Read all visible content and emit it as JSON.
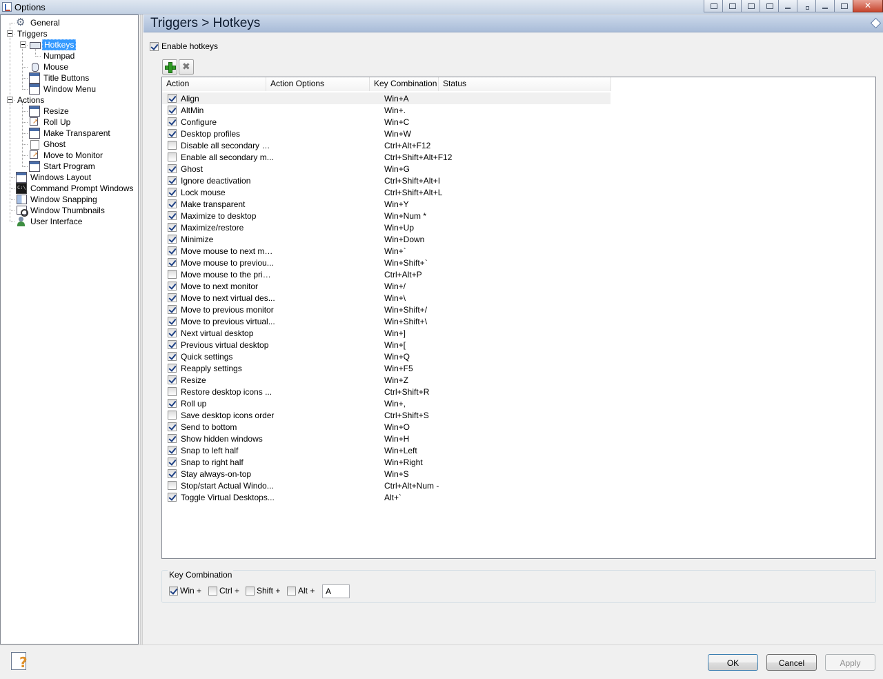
{
  "window": {
    "title": "Options"
  },
  "nav": [
    {
      "label": "General",
      "icon": "gear-icon"
    },
    {
      "label": "Triggers",
      "icon": ""
    },
    {
      "label": "Hotkeys",
      "icon": "keyboard-icon",
      "selected": true
    },
    {
      "label": "Numpad",
      "icon": ""
    },
    {
      "label": "Mouse",
      "icon": "mouse-icon"
    },
    {
      "label": "Title Buttons",
      "icon": "window-icon"
    },
    {
      "label": "Window Menu",
      "icon": "window-icon"
    },
    {
      "label": "Actions",
      "icon": ""
    },
    {
      "label": "Resize",
      "icon": "window-icon"
    },
    {
      "label": "Roll Up",
      "icon": "arrow-icon"
    },
    {
      "label": "Make Transparent",
      "icon": "window-icon"
    },
    {
      "label": "Ghost",
      "icon": "blank-icon"
    },
    {
      "label": "Move to Monitor",
      "icon": "arrow-icon"
    },
    {
      "label": "Start Program",
      "icon": "window-icon"
    },
    {
      "label": "Windows Layout",
      "icon": "window-icon"
    },
    {
      "label": "Command Prompt Windows",
      "icon": "cmd-icon"
    },
    {
      "label": "Window Snapping",
      "icon": "snap-icon"
    },
    {
      "label": "Window Thumbnails",
      "icon": "thumb-icon"
    },
    {
      "label": "User Interface",
      "icon": "user-icon"
    }
  ],
  "header": {
    "title": "Triggers > Hotkeys"
  },
  "enable_hotkeys": {
    "label": "Enable hotkeys",
    "checked": true
  },
  "columns": [
    "Action",
    "Action Options",
    "Key Combination",
    "Status"
  ],
  "rows": [
    {
      "checked": true,
      "action": "Align",
      "options": "",
      "key": "Win+A",
      "status": ""
    },
    {
      "checked": true,
      "action": "AltMin",
      "options": "",
      "key": "Win+.",
      "status": ""
    },
    {
      "checked": true,
      "action": "Configure",
      "options": "",
      "key": "Win+C",
      "status": ""
    },
    {
      "checked": true,
      "action": "Desktop profiles",
      "options": "",
      "key": "Win+W",
      "status": ""
    },
    {
      "checked": false,
      "action": "Disable all secondary m...",
      "options": "",
      "key": "Ctrl+Alt+F12",
      "status": ""
    },
    {
      "checked": false,
      "action": "Enable all secondary m...",
      "options": "",
      "key": "Ctrl+Shift+Alt+F12",
      "status": ""
    },
    {
      "checked": true,
      "action": "Ghost",
      "options": "",
      "key": "Win+G",
      "status": ""
    },
    {
      "checked": true,
      "action": "Ignore deactivation",
      "options": "",
      "key": "Ctrl+Shift+Alt+I",
      "status": ""
    },
    {
      "checked": true,
      "action": "Lock mouse",
      "options": "",
      "key": "Ctrl+Shift+Alt+L",
      "status": ""
    },
    {
      "checked": true,
      "action": "Make transparent",
      "options": "",
      "key": "Win+Y",
      "status": ""
    },
    {
      "checked": true,
      "action": "Maximize to desktop",
      "options": "",
      "key": "Win+Num *",
      "status": ""
    },
    {
      "checked": true,
      "action": "Maximize/restore",
      "options": "",
      "key": "Win+Up",
      "status": ""
    },
    {
      "checked": true,
      "action": "Minimize",
      "options": "",
      "key": "Win+Down",
      "status": ""
    },
    {
      "checked": true,
      "action": "Move mouse to next mo...",
      "options": "",
      "key": "Win+`",
      "status": ""
    },
    {
      "checked": true,
      "action": "Move mouse to previou...",
      "options": "",
      "key": "Win+Shift+`",
      "status": ""
    },
    {
      "checked": false,
      "action": "Move mouse to the prim...",
      "options": "",
      "key": "Ctrl+Alt+P",
      "status": ""
    },
    {
      "checked": true,
      "action": "Move to next monitor",
      "options": "",
      "key": "Win+/",
      "status": ""
    },
    {
      "checked": true,
      "action": "Move to next virtual des...",
      "options": "",
      "key": "Win+\\",
      "status": ""
    },
    {
      "checked": true,
      "action": "Move to previous monitor",
      "options": "",
      "key": "Win+Shift+/",
      "status": ""
    },
    {
      "checked": true,
      "action": "Move to previous virtual...",
      "options": "",
      "key": "Win+Shift+\\",
      "status": ""
    },
    {
      "checked": true,
      "action": "Next virtual desktop",
      "options": "",
      "key": "Win+]",
      "status": ""
    },
    {
      "checked": true,
      "action": "Previous virtual desktop",
      "options": "",
      "key": "Win+[",
      "status": ""
    },
    {
      "checked": true,
      "action": "Quick settings",
      "options": "",
      "key": "Win+Q",
      "status": ""
    },
    {
      "checked": true,
      "action": "Reapply settings",
      "options": "",
      "key": "Win+F5",
      "status": ""
    },
    {
      "checked": true,
      "action": "Resize",
      "options": "",
      "key": "Win+Z",
      "status": ""
    },
    {
      "checked": false,
      "action": "Restore desktop icons ...",
      "options": "",
      "key": "Ctrl+Shift+R",
      "status": ""
    },
    {
      "checked": true,
      "action": "Roll up",
      "options": "",
      "key": "Win+,",
      "status": ""
    },
    {
      "checked": false,
      "action": "Save desktop icons order",
      "options": "",
      "key": "Ctrl+Shift+S",
      "status": ""
    },
    {
      "checked": true,
      "action": "Send to bottom",
      "options": "",
      "key": "Win+O",
      "status": ""
    },
    {
      "checked": true,
      "action": "Show hidden windows",
      "options": "",
      "key": "Win+H",
      "status": ""
    },
    {
      "checked": true,
      "action": "Snap to left half",
      "options": "",
      "key": "Win+Left",
      "status": ""
    },
    {
      "checked": true,
      "action": "Snap to right half",
      "options": "",
      "key": "Win+Right",
      "status": ""
    },
    {
      "checked": true,
      "action": "Stay always-on-top",
      "options": "",
      "key": "Win+S",
      "status": ""
    },
    {
      "checked": false,
      "action": "Stop/start Actual Windo...",
      "options": "",
      "key": "Ctrl+Alt+Num -",
      "status": ""
    },
    {
      "checked": true,
      "action": "Toggle Virtual Desktops...",
      "options": "",
      "key": "Alt+`",
      "status": ""
    }
  ],
  "key_combination": {
    "legend": "Key Combination",
    "win": {
      "label": "Win +",
      "checked": true
    },
    "ctrl": {
      "label": "Ctrl +",
      "checked": false
    },
    "shift": {
      "label": "Shift +",
      "checked": false
    },
    "alt": {
      "label": "Alt +",
      "checked": false
    },
    "key": "A"
  },
  "buttons": {
    "ok": "OK",
    "cancel": "Cancel",
    "apply": "Apply"
  }
}
